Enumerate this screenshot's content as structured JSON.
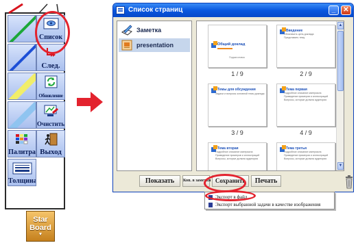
{
  "palette": {
    "commands": {
      "list": "Список",
      "next": "След.",
      "update": "Обновление",
      "clear": "Очистить",
      "colors": "Палитра",
      "exit": "Выход",
      "thickness": "Толщина"
    },
    "pen_colors": [
      "#d8141e",
      "#1ca838",
      "#1d4fd6",
      "#f1ee6a",
      "#8fc4f0"
    ],
    "logo": {
      "line1": "Star",
      "line2": "Board"
    }
  },
  "window": {
    "title": "Список страниц",
    "notes": [
      {
        "label": "Заметка",
        "selected": false
      },
      {
        "label": "presentation",
        "selected": true
      }
    ],
    "pages": [
      {
        "title": "Общий доклад",
        "bullets": [],
        "subtitle": "Подзаголовок",
        "number": "1 / 9"
      },
      {
        "title": "Введение",
        "bullets": [
          "Обозначить цель доклада",
          "Представить тему"
        ],
        "subtitle": "",
        "number": "2 / 9"
      },
      {
        "title": "Темы для обсуждения",
        "bullets": [
          "Задачи и вопросы основной темы доклада"
        ],
        "subtitle": "",
        "number": "3 / 9"
      },
      {
        "title": "Тема первая",
        "bullets": [
          "Подробное описание материала",
          "Приведение примеров и иллюстраций",
          "Вопросы, которые должна аудитория"
        ],
        "subtitle": "",
        "number": "4 / 9"
      },
      {
        "title": "Тема вторая",
        "bullets": [
          "Подробное описание материала",
          "Приведение примеров и иллюстраций",
          "Вопросы, которые должна аудитория"
        ],
        "subtitle": "",
        "number": ""
      },
      {
        "title": "Тема третья",
        "bullets": [
          "Подробное описание материала",
          "Приведение примеров и иллюстраций",
          "Вопросы, которые должна аудитория"
        ],
        "subtitle": "",
        "number": ""
      }
    ],
    "buttons": {
      "show": "Показать",
      "copy_to_note": "Коп. в заметки",
      "save": "Сохранить",
      "print": "Печать"
    },
    "save_menu": {
      "export_file": "Экспорт в файл",
      "export_selected": "Экспорт выбранной задачи в качестве изображения"
    }
  },
  "colors": {
    "highlight": "#e3232e",
    "accent": "#0a58e0"
  }
}
